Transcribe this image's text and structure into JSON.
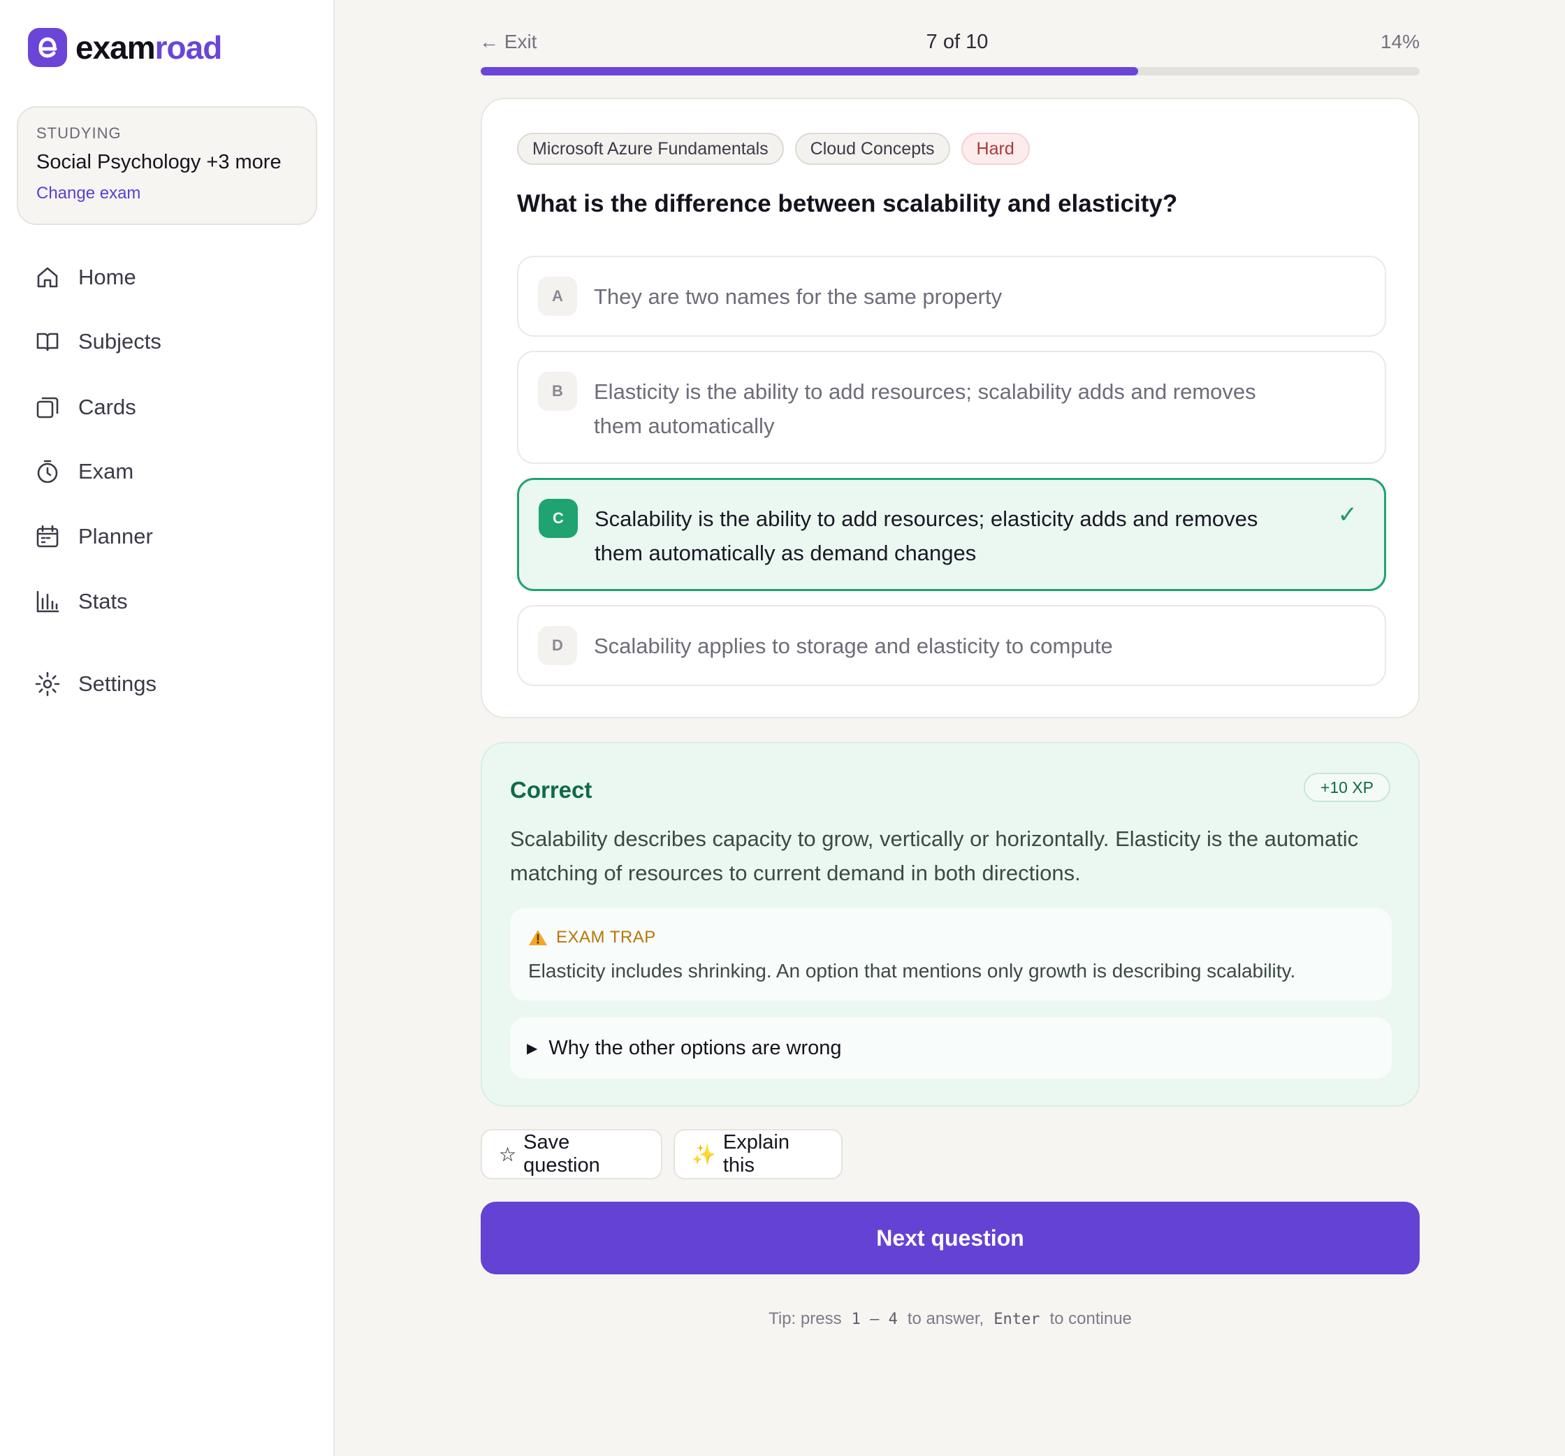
{
  "app": {
    "logo_part1": "exam",
    "logo_part2": "road"
  },
  "sidebar": {
    "studying_label": "STUDYING",
    "studying_title": "Social Psychology +3 more",
    "change_exam": "Change exam",
    "items": [
      {
        "label": "Home",
        "icon": "home-icon"
      },
      {
        "label": "Subjects",
        "icon": "book-icon"
      },
      {
        "label": "Cards",
        "icon": "cards-icon"
      },
      {
        "label": "Exam",
        "icon": "timer-icon"
      },
      {
        "label": "Planner",
        "icon": "calendar-icon"
      },
      {
        "label": "Stats",
        "icon": "bar-chart-icon"
      },
      {
        "label": "Settings",
        "icon": "gear-icon"
      }
    ]
  },
  "topbar": {
    "exit": "← Exit",
    "count": "7 of 10",
    "percent": "14%",
    "progress_fraction": 0.7
  },
  "question": {
    "tags": [
      "Microsoft Azure Fundamentals",
      "Cloud Concepts",
      "Hard"
    ],
    "text": "What is the difference between scalability and elasticity?",
    "options": [
      {
        "letter": "A",
        "text": "They are two names for the same property"
      },
      {
        "letter": "B",
        "text": "Elasticity is the ability to add resources; scalability adds and removes them automatically"
      },
      {
        "letter": "C",
        "text": "Scalability is the ability to add resources; elasticity adds and removes them automatically as demand changes",
        "correct": true
      },
      {
        "letter": "D",
        "text": "Scalability applies to storage and elasticity to compute"
      }
    ],
    "check_mark": "✓"
  },
  "feedback": {
    "title": "Correct",
    "xp": "+10 XP",
    "body": "Scalability describes capacity to grow, vertically or horizontally. Elasticity is the automatic matching of resources to current demand in both directions.",
    "trap_label": "EXAM TRAP",
    "trap_body": "Elasticity includes shrinking. An option that mentions only growth is describing scalability.",
    "why_label": "Why the other options are wrong"
  },
  "actions": {
    "save_icon": "☆",
    "save": "Save question",
    "explain_icon": "✨",
    "explain": "Explain this",
    "next": "Next question"
  },
  "tip": {
    "prefix": "Tip: press",
    "keys": "1 – 4",
    "middle": "to answer,",
    "enter": "Enter",
    "suffix": "to continue"
  },
  "colors": {
    "accent": "#6a45d8",
    "correct": "#1fa371",
    "trap": "#b87508"
  }
}
